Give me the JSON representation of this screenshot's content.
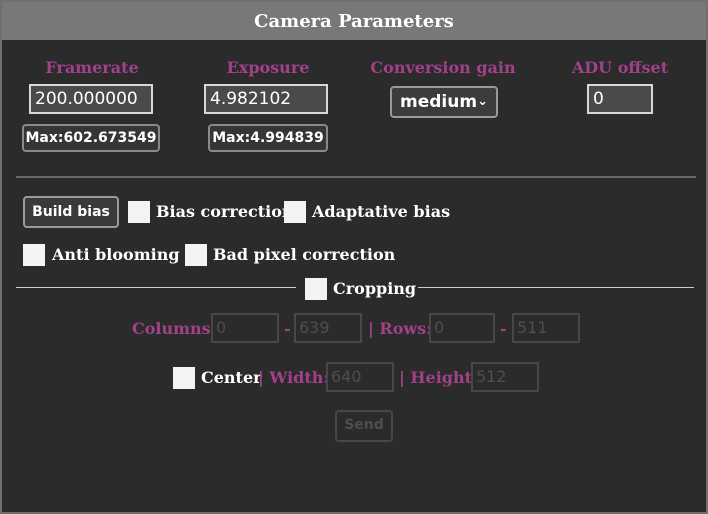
{
  "title": "Camera Parameters",
  "framerate": {
    "label": "Framerate",
    "value": "200.000000",
    "max": "Max:602.673549"
  },
  "exposure": {
    "label": "Exposure",
    "value": "4.982102",
    "max": "Max:4.994839"
  },
  "conversion_gain": {
    "label": "Conversion gain",
    "selected": "medium"
  },
  "adu_offset": {
    "label": "ADU offset",
    "value": "0"
  },
  "build_bias_label": "Build bias",
  "bias_correction_label": "Bias correction",
  "adaptative_bias_label": "Adaptative bias",
  "anti_blooming_label": "Anti blooming",
  "bad_pixel_label": "Bad pixel correction",
  "cropping": {
    "label": "Cropping",
    "columns_label": "Columns:",
    "col_from": "0",
    "col_to": "639",
    "rows_label": "| Rows:",
    "row_from": "0",
    "row_to": "511",
    "dash": "-",
    "center_label": "Center",
    "width_label": "| Width:",
    "width_value": "640",
    "height_label": "| Height:",
    "height_value": "512",
    "send_label": "Send"
  },
  "colors": {
    "accent": "#a2418a",
    "header_bg": "#787878",
    "panel_bg": "#2b2b2b"
  }
}
